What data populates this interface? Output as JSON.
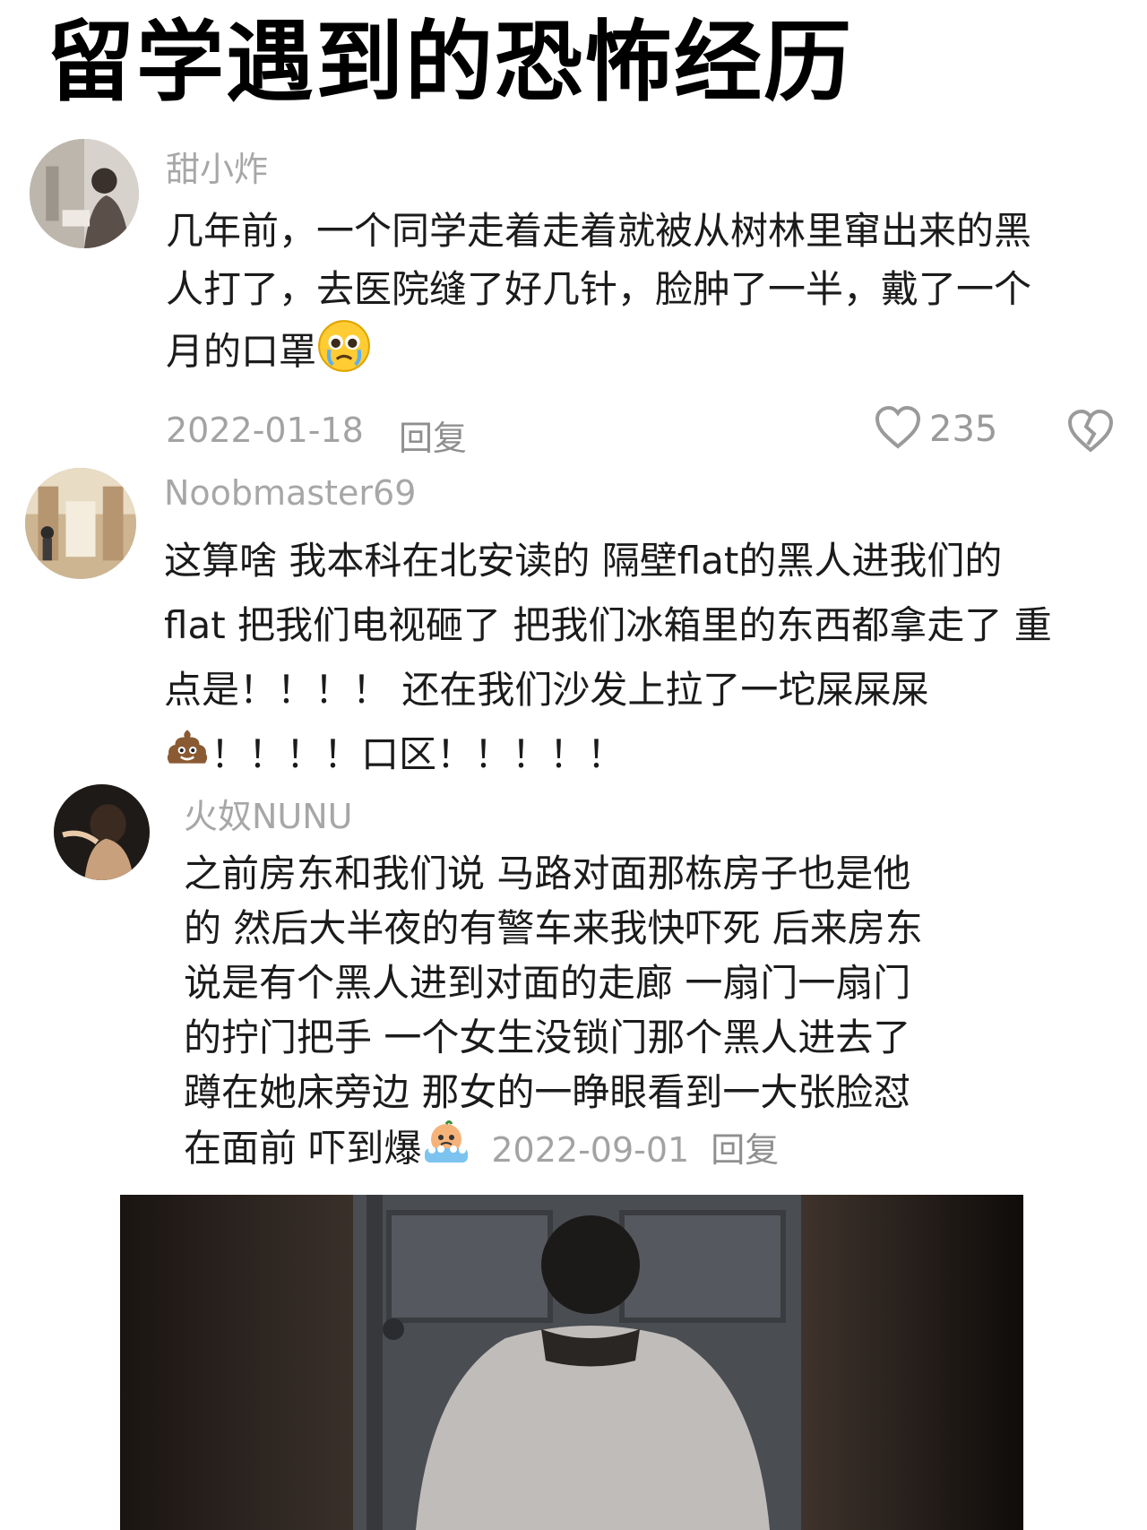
{
  "title": "留学遇到的恐怖经历",
  "comments": [
    {
      "username": "甜小炸",
      "lines": [
        "几年前，一个同学走着走着就被从树林里窜出来的黑",
        "人打了，去医院缝了好几针，脸肿了一半，戴了一个",
        "月的口罩"
      ],
      "emoji": "pleading-crying-emoji",
      "date": "2022-01-18",
      "reply": "回复",
      "likes": "235"
    },
    {
      "username": "Noobmaster69",
      "lines": [
        "这算啥 我本科在北安读的 隔壁flat的黑人进我们的",
        "flat 把我们电视砸了 把我们冰箱里的东西都拿走了 重",
        "点是！！！！ 还在我们沙发上拉了一坨屎屎屎",
        "！！！！口区！！！！！"
      ],
      "emoji": "poop-emoji"
    },
    {
      "username": "火奴NUNU",
      "lines": [
        "之前房东和我们说 马路对面那栋房子也是他",
        "的 然后大半夜的有警车来我快吓死 后来房东",
        "说是有个黑人进到对面的走廊 一扇门一扇门",
        "的拧门把手 一个女生没锁门那个黑人进去了",
        "蹲在她床旁边 那女的一睁眼看到一大张脸怼",
        "在面前 吓到爆"
      ],
      "emoji": "crying-in-bath-emoji",
      "date": "2022-09-01",
      "reply": "回复"
    }
  ],
  "icons": {
    "like": "heart-outline-icon",
    "dislike": "broken-heart-icon"
  },
  "colors": {
    "text": "#1b1b1b",
    "muted": "#a3a3a3"
  }
}
